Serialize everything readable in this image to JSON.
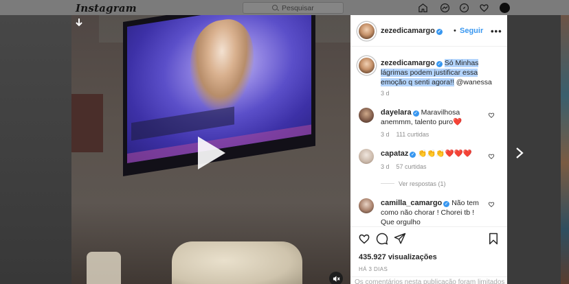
{
  "topbar": {
    "logo": "Instagram",
    "search_placeholder": "Pesquisar",
    "nav_icons": [
      "home-icon",
      "messenger-icon",
      "explore-icon",
      "heart-icon",
      "profile-avatar"
    ]
  },
  "post": {
    "author": "zezedicamargo",
    "follow_label": "Seguir",
    "separator": "•",
    "caption_highlight": "Só Minhas lágrimas podem justificar essa emoção q senti agora!!",
    "caption_mention": "@wanessa",
    "caption_time": "3 d",
    "comments": [
      {
        "user": "dayelara",
        "verified": true,
        "text": "Maravilhosa anemmm, talento puro❤️",
        "time": "3 d",
        "likes": "111 curtidas"
      },
      {
        "user": "capataz",
        "verified": true,
        "text": "👏👏👏❤️❤️❤️",
        "time": "3 d",
        "likes": "57 curtidas",
        "replies_label": "Ver respostas (1)"
      },
      {
        "user": "camilla_camargo",
        "verified": true,
        "text": "Não tem como não chorar ! Chorei tb ! Que orgulho"
      }
    ],
    "views": "435.927 visualizações",
    "date": "HÁ 3 DIAS",
    "comments_limited": "Os comentários nesta publicação foram limitados"
  },
  "colors": {
    "accent": "#3897f0",
    "text": "#262626",
    "muted": "#8e8e8e",
    "heart": "#ed4956",
    "highlight": "#b3d4fc"
  }
}
